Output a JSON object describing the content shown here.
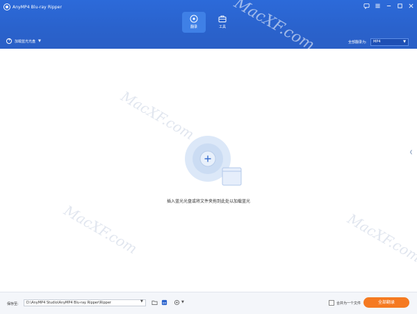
{
  "window": {
    "title": "AnyMP4 Blu-ray Ripper"
  },
  "tabs": [
    {
      "label": "翻录",
      "icon": "disc-icon",
      "active": true
    },
    {
      "label": "工具",
      "icon": "toolbox-icon",
      "active": false
    }
  ],
  "toolbar": {
    "load_label": "加载蓝光光盘",
    "rip_all_to_label": "全部翻录为:",
    "format_value": "MP4"
  },
  "main": {
    "hint": "插入蓝光光盘或将文件夹拖到此处以加载蓝光"
  },
  "footer": {
    "save_label": "保存至:",
    "path_value": "D:\\AnyMP4 Studio\\AnyMP4 Blu-ray Ripper\\Ripper",
    "merge_label": "合并为一个文件",
    "rip_all_button": "全部翻录"
  },
  "watermark": {
    "text": "MacXF.com"
  },
  "colors": {
    "header_blue": "#2a62cc",
    "active_tab": "#3f80e6",
    "accent_orange": "#f57a21"
  }
}
